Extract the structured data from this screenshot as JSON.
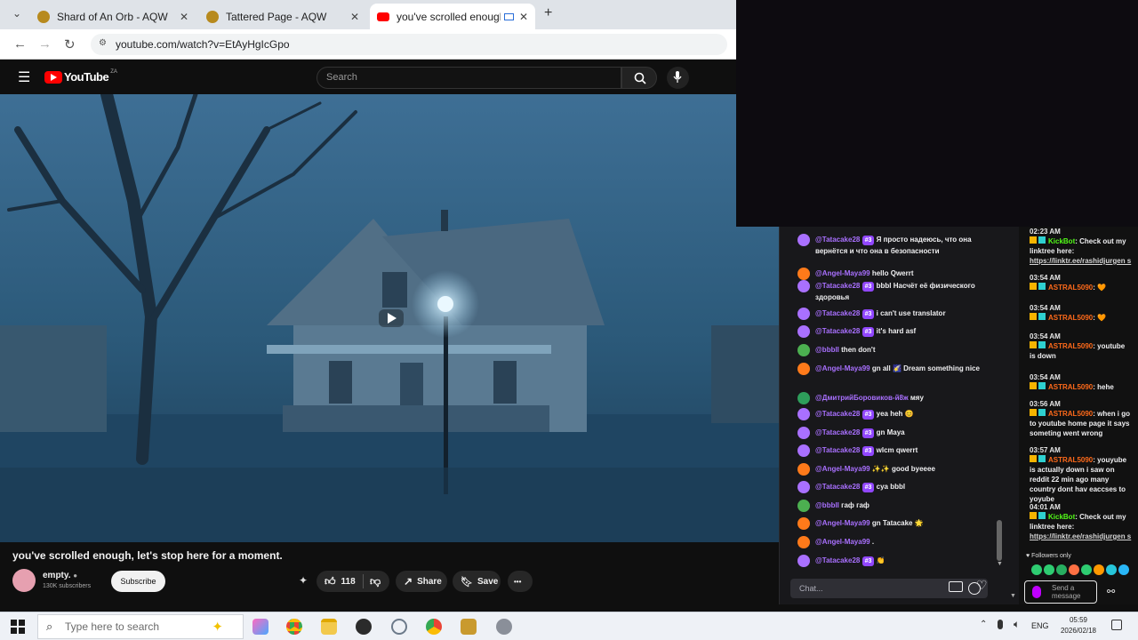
{
  "browser": {
    "tabs": [
      {
        "title": "Shard of An Orb - AQW",
        "active": false
      },
      {
        "title": "Tattered Page - AQW",
        "active": false
      },
      {
        "title": "you've scrolled enough, let's",
        "active": true
      }
    ],
    "new_tab": "+",
    "close_glyph": "✕",
    "url": "youtube.com/watch?v=EtAyHgIcGpo"
  },
  "youtube": {
    "logo": "YouTube",
    "region": "ZA",
    "search_placeholder": "Search",
    "video_title": "you've scrolled enough, let's stop here for a moment.",
    "channel_name": "empty.",
    "subscribers": "130K subscribers",
    "subscribe_label": "Subscribe",
    "likes": "118",
    "share_label": "Share",
    "save_label": "Save",
    "more_label": "•••"
  },
  "chat_left": {
    "messages": [
      {
        "user": "@Tatacake28",
        "badge": "#3",
        "text": "Я просто надеюсь, что она вернётся и что она в безопасности",
        "avatar_color": "#a970ff"
      },
      {
        "user": "@Angel-Maya99",
        "badge": "",
        "text": "hello Qwerrt",
        "avatar_color": "#ff7a1a"
      },
      {
        "user": "@Tatacake28",
        "badge": "#3",
        "text": "bbbl Насчёт её физического здоровья",
        "avatar_color": "#a970ff"
      },
      {
        "user": "@Tatacake28",
        "badge": "#3",
        "text": "i can't use translator",
        "avatar_color": "#a970ff"
      },
      {
        "user": "@Tatacake28",
        "badge": "#3",
        "text": "it's hard asf",
        "avatar_color": "#a970ff"
      },
      {
        "user": "@bbbll",
        "badge": "",
        "text": "then don't",
        "avatar_color": "#4caf50"
      },
      {
        "user": "@Angel-Maya99",
        "badge": "",
        "text": "gn all 🌠 Dream something nice",
        "avatar_color": "#ff7a1a"
      },
      {
        "user": "@ДмитрийБоровиков-й8ж",
        "badge": "",
        "text": "мяу",
        "avatar_color": "#2e9e5b"
      },
      {
        "user": "@Tatacake28",
        "badge": "#3",
        "text": "yea heh 😊",
        "avatar_color": "#a970ff"
      },
      {
        "user": "@Tatacake28",
        "badge": "#3",
        "text": "gn Maya",
        "avatar_color": "#a970ff"
      },
      {
        "user": "@Tatacake28",
        "badge": "#3",
        "text": "wlcm qwerrt",
        "avatar_color": "#a970ff"
      },
      {
        "user": "@Angel-Maya99",
        "badge": "",
        "text": "✨✨ good byeeee",
        "avatar_color": "#ff7a1a"
      },
      {
        "user": "@Tatacake28",
        "badge": "#3",
        "text": "cya bbbl",
        "avatar_color": "#a970ff"
      },
      {
        "user": "@bbbll",
        "badge": "",
        "text": "гаф гаф",
        "avatar_color": "#4caf50"
      },
      {
        "user": "@Angel-Maya99",
        "badge": "",
        "text": "gn Tatacake 🌟",
        "avatar_color": "#ff7a1a"
      },
      {
        "user": "@Angel-Maya99",
        "badge": "",
        "text": ".",
        "avatar_color": "#ff7a1a"
      },
      {
        "user": "@Tatacake28",
        "badge": "#3",
        "text": "👏",
        "avatar_color": "#a970ff"
      }
    ],
    "input_placeholder": "Chat..."
  },
  "chat_right": {
    "messages": [
      {
        "time": "02:23 AM",
        "user": "KickBot",
        "text": "Check out my linktree here:",
        "link": "https://linktr.ee/rashidjurgen s",
        "user_color": "#53fc18"
      },
      {
        "time": "03:54 AM",
        "user": "ASTRAL5090",
        "text": "🧡",
        "link": "",
        "user_color": "#ff6a1a"
      },
      {
        "time": "03:54 AM",
        "user": "ASTRAL5090",
        "text": "🧡",
        "link": "",
        "user_color": "#ff6a1a"
      },
      {
        "time": "03:54 AM",
        "user": "ASTRAL5090",
        "text": "youtube is down",
        "link": "",
        "user_color": "#ff6a1a"
      },
      {
        "time": "03:54 AM",
        "user": "ASTRAL5090",
        "text": "hehe",
        "link": "",
        "user_color": "#ff6a1a"
      },
      {
        "time": "03:56 AM",
        "user": "ASTRAL5090",
        "text": "when i go to youtube home page it says someting went wrong",
        "link": "",
        "user_color": "#ff6a1a"
      },
      {
        "time": "03:57 AM",
        "user": "ASTRAL5090",
        "text": "youyube is actually down i saw on reddit 22 min ago many country dont hav eaccses to yoyube",
        "link": "",
        "user_color": "#ff6a1a"
      },
      {
        "time": "04:01 AM",
        "user": "KickBot",
        "text": "Check out my linktree here:",
        "link": "https://linktr.ee/rashidjurgen s",
        "user_color": "#53fc18"
      }
    ],
    "followers_only": "Followers only",
    "send_label": "Send a message"
  },
  "taskbar": {
    "search_placeholder": "Type here to search",
    "lang": "ENG",
    "time": "05:59",
    "date": "2026/02/18"
  },
  "colors": {
    "twitch_purple": "#9147ff",
    "kick_green": "#53fc18",
    "youtube_red": "#ff0000"
  }
}
